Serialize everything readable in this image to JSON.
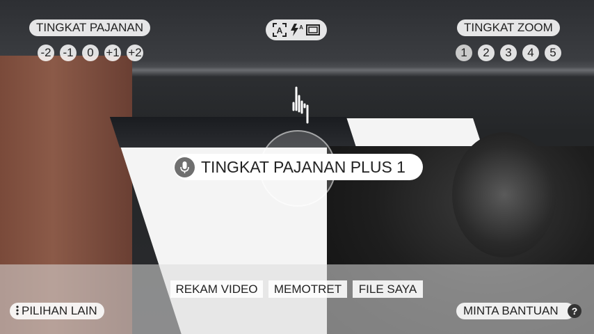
{
  "exposure": {
    "title": "TINGKAT PAJANAN",
    "levels": [
      "-2",
      "-1",
      "0",
      "+1",
      "+2"
    ]
  },
  "zoom": {
    "title": "TINGKAT ZOOM",
    "levels": [
      "1",
      "2",
      "3",
      "4",
      "5"
    ],
    "active_level": "1"
  },
  "top_icons": [
    "auto-scene-icon",
    "auto-flash-icon",
    "aspect-ratio-icon"
  ],
  "toast": {
    "text": "TINGKAT PAJANAN PLUS 1",
    "icon": "microphone-icon"
  },
  "modes": {
    "video": "REKAM VIDEO",
    "photo": "MEMOTRET",
    "files": "FILE SAYA"
  },
  "more_options": "PILIHAN LAIN",
  "help": {
    "label": "MINTA BANTUAN",
    "icon_glyph": "?"
  },
  "colors": {
    "pill_bg": "#ffffff",
    "text": "#222222",
    "toast_icon_bg": "#6f6f6f"
  }
}
